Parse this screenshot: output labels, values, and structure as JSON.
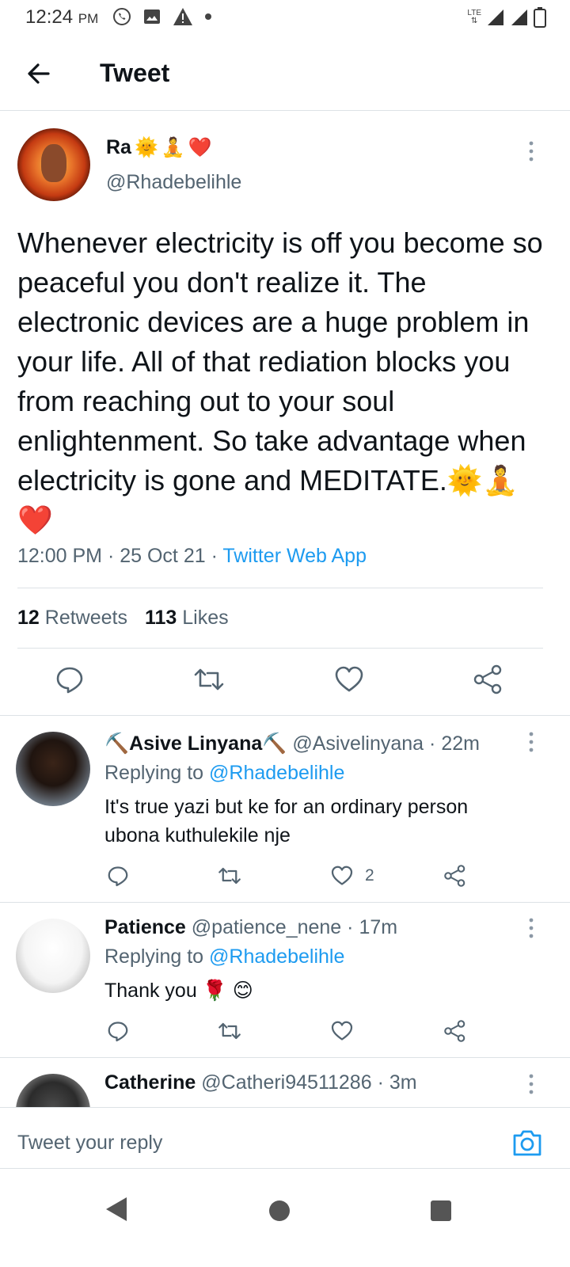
{
  "status_bar": {
    "time": "12:24",
    "ampm": "PM",
    "network": "LTE"
  },
  "header": {
    "title": "Tweet"
  },
  "tweet": {
    "author_name": "Ra",
    "author_emojis": [
      "🌞",
      "🧘",
      "❤️"
    ],
    "handle": "@Rhadebelihle",
    "text": "Whenever electricity is off you become so peaceful you don't realize it. The electronic devices are a huge problem in your life. All of that rediation blocks you from reaching out to your soul enlightenment. So take advantage when electricity is gone and MEDITATE.🌞🧘❤️",
    "time": "12:00 PM",
    "date": "25 Oct 21",
    "source": "Twitter Web App",
    "retweets_count": "12",
    "retweets_label": "Retweets",
    "likes_count": "113",
    "likes_label": "Likes"
  },
  "replies": [
    {
      "name": "⛏️Asive Linyana⛏️",
      "handle": "@Asivelinyana",
      "time": "22m",
      "replying_label": "Replying to",
      "replying_to": "@Rhadebelihle",
      "text": "It's true yazi but ke for an ordinary person ubona kuthulekile nje",
      "likes": "2"
    },
    {
      "name": "Patience",
      "handle": "@patience_nene",
      "time": "17m",
      "replying_label": "Replying to",
      "replying_to": "@Rhadebelihle",
      "text": "Thank you 🌹 😊",
      "likes": ""
    },
    {
      "name": "Catherine",
      "handle": "@Catheri94511286",
      "time": "3m"
    }
  ],
  "compose": {
    "placeholder": "Tweet your reply"
  },
  "colors": {
    "accent": "#1d9bf0",
    "text_primary": "#0f1419",
    "text_secondary": "#536471",
    "divider": "#dde2e6"
  },
  "icons": {
    "status_left": [
      "whatsapp-icon",
      "gallery-icon",
      "warning-icon",
      "dot-icon"
    ],
    "status_right": [
      "lte-icon",
      "signal-icon",
      "signal-icon",
      "battery-icon"
    ],
    "actions": [
      "reply-icon",
      "retweet-icon",
      "like-icon",
      "share-icon"
    ],
    "nav": [
      "back-triangle-icon",
      "home-circle-icon",
      "recents-square-icon"
    ]
  }
}
